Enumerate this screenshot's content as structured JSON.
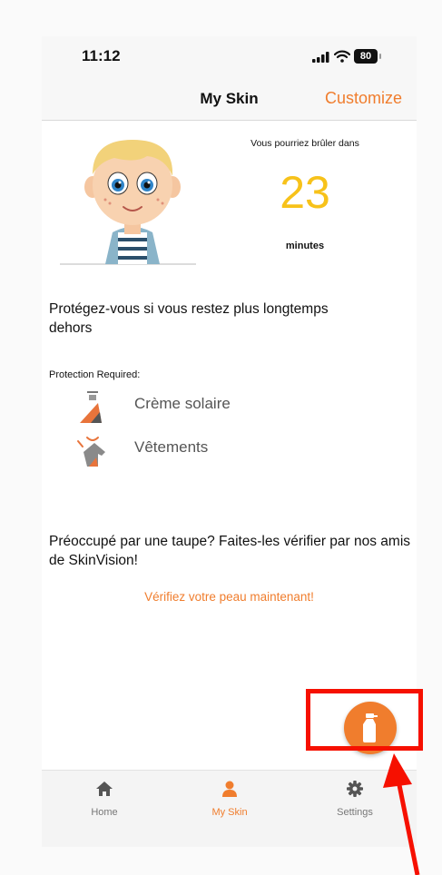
{
  "status_bar": {
    "time": "11:12",
    "battery": "80"
  },
  "nav": {
    "title": "My Skin",
    "customize_label": "Customize"
  },
  "burn": {
    "label": "Vous pourriez brûler dans",
    "minutes": "23",
    "unit": "minutes"
  },
  "protection": {
    "message": "Protégez-vous si vous restez plus longtemps dehors",
    "required_label": "Protection Required:",
    "items": [
      {
        "label": "Crème solaire",
        "icon": "sunscreen-icon"
      },
      {
        "label": "Vêtements",
        "icon": "clothing-icon"
      }
    ]
  },
  "mole": {
    "message": "Préoccupé par une taupe? Faites-les vérifier par nos amis de SkinVision!",
    "link": "Vérifiez votre peau maintenant!"
  },
  "fab": {
    "icon": "sunscreen-bottle-icon"
  },
  "tabs": [
    {
      "label": "Home",
      "icon": "home-icon",
      "active": false
    },
    {
      "label": "My Skin",
      "icon": "person-icon",
      "active": true
    },
    {
      "label": "Settings",
      "icon": "gear-icon",
      "active": false
    }
  ],
  "colors": {
    "accent": "#f07d2d",
    "minutes": "#f7c21a",
    "annotation": "#f61000"
  }
}
